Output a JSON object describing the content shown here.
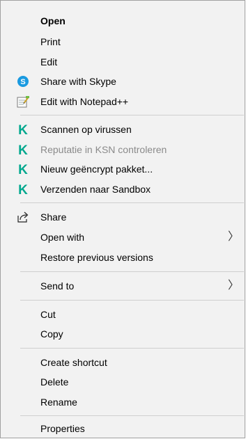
{
  "menu": {
    "open": "Open",
    "print": "Print",
    "edit": "Edit",
    "share_skype": "Share with Skype",
    "edit_notepad": "Edit with Notepad++",
    "kas_scan": "Scannen op virussen",
    "kas_reputation": "Reputatie in KSN controleren",
    "kas_encrypt": "Nieuw geëncrypt pakket...",
    "kas_sandbox": "Verzenden naar Sandbox",
    "share": "Share",
    "open_with": "Open with",
    "restore": "Restore previous versions",
    "send_to": "Send to",
    "cut": "Cut",
    "copy": "Copy",
    "create_shortcut": "Create shortcut",
    "delete": "Delete",
    "rename": "Rename",
    "properties": "Properties"
  },
  "submenu_arrow": "〉",
  "icons": {
    "skype": "skype-icon",
    "notepad": "notepad-plus-plus-icon",
    "kaspersky": "kaspersky-icon",
    "share": "share-icon"
  },
  "colors": {
    "menu_bg": "#f2f2f2",
    "separator": "#cfcfcf",
    "skype": "#1a9ae0",
    "kaspersky": "#00a88e",
    "disabled_text": "#8a8a8a"
  }
}
